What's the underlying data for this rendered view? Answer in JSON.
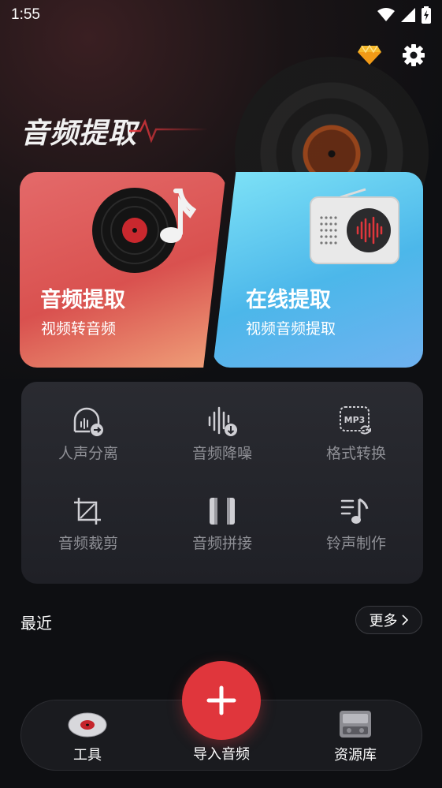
{
  "status_bar": {
    "time": "1:55",
    "icons": [
      "wifi-icon",
      "cellular-icon",
      "battery-charging-icon"
    ]
  },
  "header": {
    "title": "音频提取",
    "actions": [
      "vip-diamond-icon",
      "settings-gear-icon"
    ]
  },
  "feature_cards": [
    {
      "title": "音频提取",
      "subtitle": "视频转音频",
      "icon": "vinyl-music-note-icon",
      "color": "#e0595a"
    },
    {
      "title": "在线提取",
      "subtitle": "视频音频提取",
      "icon": "radio-icon",
      "color": "#55bdeb"
    }
  ],
  "tools": [
    {
      "label": "人声分离",
      "icon": "voice-separate-icon"
    },
    {
      "label": "音频降噪",
      "icon": "noise-reduction-icon"
    },
    {
      "label": "格式转换",
      "icon": "format-convert-icon",
      "badge": "MP3"
    },
    {
      "label": "音频裁剪",
      "icon": "crop-icon"
    },
    {
      "label": "音频拼接",
      "icon": "merge-icon"
    },
    {
      "label": "铃声制作",
      "icon": "ringtone-icon"
    }
  ],
  "recent": {
    "label": "最近",
    "more_label": "更多"
  },
  "bottom_nav": {
    "tools_label": "工具",
    "import_label": "导入音频",
    "library_label": "资源库"
  },
  "colors": {
    "accent_red": "#e0363c",
    "background": "#0e0f12",
    "panel": "#25262c"
  }
}
